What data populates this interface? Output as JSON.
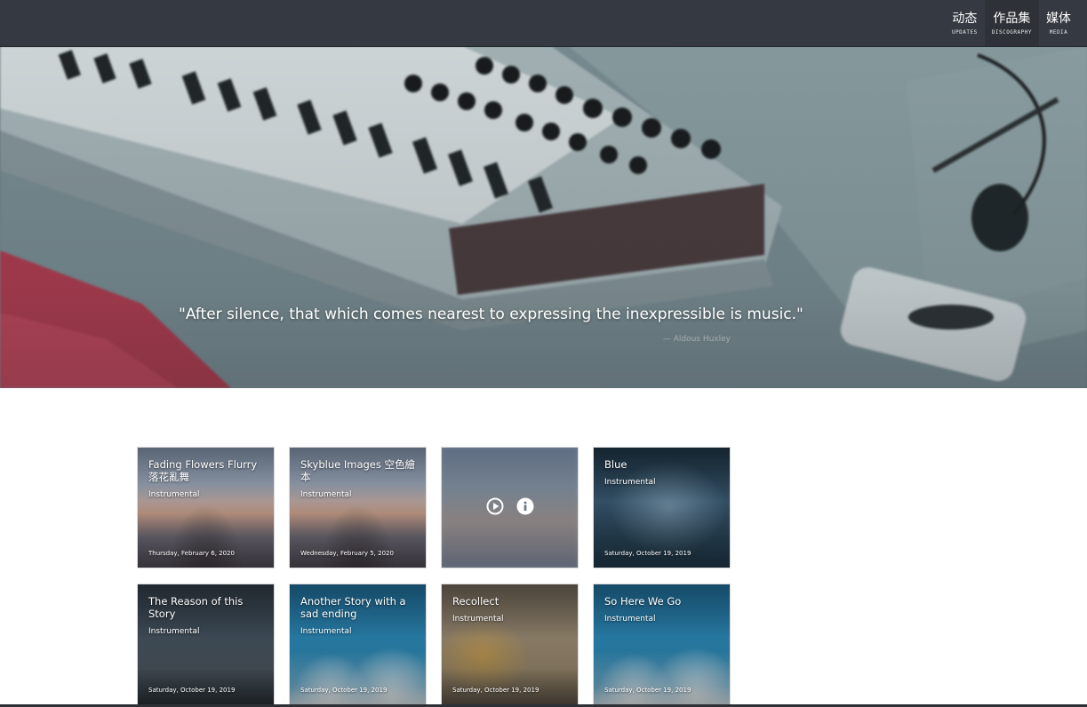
{
  "nav": {
    "items": [
      {
        "zh": "动态",
        "en": "UPDATES"
      },
      {
        "zh": "作品集",
        "en": "DISCOGRAPHY"
      },
      {
        "zh": "媒体",
        "en": "MEDIA"
      }
    ]
  },
  "hero": {
    "quote": "\"After silence, that which comes nearest to expressing the inexpressible is music.\"",
    "author": "— Aldous Huxley"
  },
  "albums": [
    {
      "title": "Fading Flowers Flurry 落花亂舞",
      "genre": "Instrumental",
      "date": "Thursday, February 6, 2020",
      "art": "temple-icon"
    },
    {
      "title": "Skyblue Images 空色繪本",
      "genre": "Instrumental",
      "date": "Wednesday, February 5, 2020",
      "art": "temple-icon"
    },
    {
      "title": "",
      "genre": "",
      "date": "",
      "art": "temple-icon"
    },
    {
      "title": "Blue",
      "genre": "Instrumental",
      "date": "Saturday, October 19, 2019",
      "art": "starfield-icon"
    },
    {
      "title": "The Reason of this Story",
      "genre": "Instrumental",
      "date": "Saturday, October 19, 2019",
      "art": "calligraphy-icon"
    },
    {
      "title": "Another Story with a sad ending",
      "genre": "Instrumental",
      "date": "Saturday, October 19, 2019",
      "art": "sky-clouds-icon"
    },
    {
      "title": "Recollect",
      "genre": "Instrumental",
      "date": "Saturday, October 19, 2019",
      "art": "sepia-map-icon"
    },
    {
      "title": "So Here We Go",
      "genre": "Instrumental",
      "date": "Saturday, October 19, 2019",
      "art": "sky-clouds-icon"
    }
  ],
  "hover_actions": {
    "play_icon": "play-circle-icon",
    "info_icon": "info-circle-icon"
  },
  "colors": {
    "topbar": "#353a42",
    "card_text": "#ffffff",
    "quote_author": "#a4acaf"
  }
}
